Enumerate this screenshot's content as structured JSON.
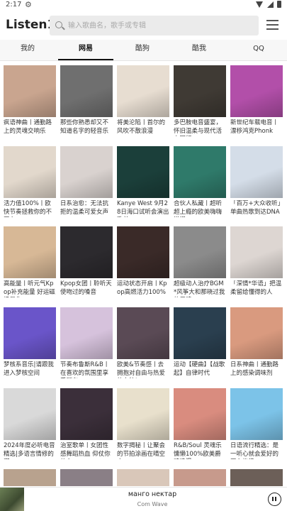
{
  "status_bar": {
    "time": "2:17"
  },
  "header": {
    "title": "Listen1",
    "search_placeholder": "输入歌曲名，歌手或专辑"
  },
  "tabs": [
    {
      "label": "我的",
      "active": false
    },
    {
      "label": "网易",
      "active": true
    },
    {
      "label": "酷狗",
      "active": false
    },
    {
      "label": "酷我",
      "active": false
    },
    {
      "label": "QQ",
      "active": false
    }
  ],
  "playlists": [
    {
      "caption": "疯语神曲丨通勤路上的灵魂交响乐",
      "cover": "#c9a58f"
    },
    {
      "caption": "那些你熟悉却又不知道名字的轻音乐",
      "cover": "#6f6f6f"
    },
    {
      "caption": "将美沦陷丨首尔的风吹不散浪漫",
      "cover": "#e7ddd1"
    },
    {
      "caption": "多巴胺电音盛宴，怀旧温柔与现代活力同行",
      "cover": "#3f3a34"
    },
    {
      "caption": "新世纪车载电音丨漂移鸿克Phonk",
      "cover": "#b24fa9"
    },
    {
      "caption": "活力值100%丨欧快节奏拯救你的不开心",
      "cover": "#e2d8cc"
    },
    {
      "caption": "日系治愈：无法抗拒的温柔可爱女声",
      "cover": "#d9d2cf"
    },
    {
      "caption": "Kanye West 9月28日海口试听会演出歌单",
      "cover": "#1b3f3a"
    },
    {
      "caption": "合伙人私藏丨超听超上瘾的欧美嗨嗨说唱",
      "cover": "#2f7a6a"
    },
    {
      "caption": "「百万+大众收听」单曲热歌到达DNA",
      "cover": "#d4dde8"
    },
    {
      "caption": "高能量丨听元气Kpop补充能量 好运磁场显化",
      "cover": "#d7b896"
    },
    {
      "caption": "Kpop女团丨聆听天使吻过的嗓音",
      "cover": "#2c2a2e"
    },
    {
      "caption": "运动状态开启丨Kpop高燃活力100%",
      "cover": "#3a2a28"
    },
    {
      "caption": "超级动人治疗BGM*风筝大和那晓过我的灵魂",
      "cover": "#8b8b8b"
    },
    {
      "caption": "「深情*华语」把温柔留给懂得的人",
      "cover": "#ddd6d2"
    },
    {
      "caption": "梦核系音乐|请跟我进入梦核空间",
      "cover": "#6a55c9"
    },
    {
      "caption": "节奏布鲁斯R&B丨在喜欢的氛围里享受所有",
      "cover": "#d6c2dc"
    },
    {
      "caption": "欧美&节奏感丨去拥抱对自由与热爱的向往!",
      "cover": "#5a4a55"
    },
    {
      "caption": "运动【硬曲】【战歌起】自律时代",
      "cover": "#2a3f4f"
    },
    {
      "caption": "日系神曲丨通勤路上的感染调味剂",
      "cover": "#d99a7f"
    },
    {
      "caption": "2024年度必听电音精选|多语言情修的潮",
      "cover": "#d9d9d9"
    },
    {
      "caption": "治室歌单丨女团性感舞蹈热血 仰仗你的心",
      "cover": "#3b2f3a"
    },
    {
      "caption": "数字揭秘丨让聚会的节拍涂画在晴空中",
      "cover": "#e8e0cc"
    },
    {
      "caption": "R&B/Soul 灵魂乐 慵懒100%欧美爵魂浪漫",
      "cover": "#d98c7f"
    },
    {
      "caption": "日语流行精选：是一听心就会爱好的开心旋律",
      "cover": "#7cc3e8"
    }
  ],
  "player": {
    "title": "манго нектар",
    "artist": "Com Wave"
  }
}
